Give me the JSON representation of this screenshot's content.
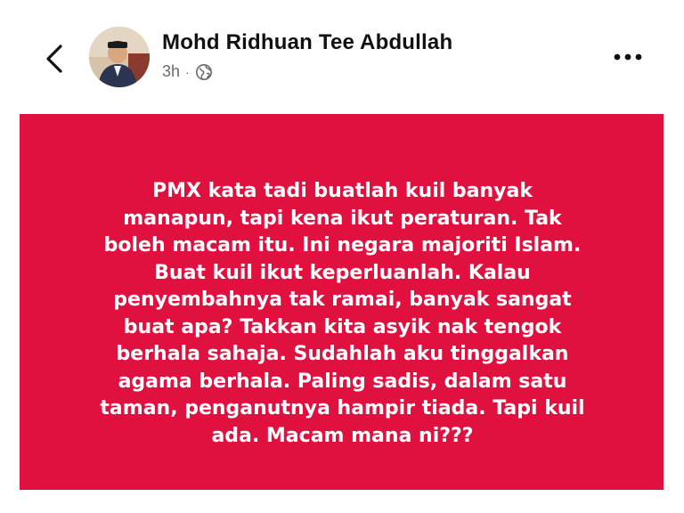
{
  "header": {
    "author_name": "Mohd Ridhuan Tee Abdullah",
    "timestamp": "3h",
    "separator": "·",
    "audience_icon": "globe-icon",
    "back_icon": "chevron-left-icon",
    "more_icon": "more-horizontal-icon"
  },
  "post": {
    "background_color": "#e0103f",
    "text_color": "#ffffff",
    "lines": [
      "PMX kata tadi buatlah kuil banyak",
      "manapun, tapi kena ikut peraturan. Tak",
      "boleh  macam itu. Ini negara majoriti Islam.",
      "Buat kuil ikut keperluanlah. Kalau",
      "penyembahnya tak ramai, banyak sangat",
      "buat apa? Takkan kita asyik nak tengok",
      "berhala sahaja. Sudahlah aku tinggalkan",
      "agama berhala. Paling sadis, dalam satu",
      "taman, penganutnya hampir tiada. Tapi kuil",
      "ada. Macam mana ni???"
    ]
  }
}
